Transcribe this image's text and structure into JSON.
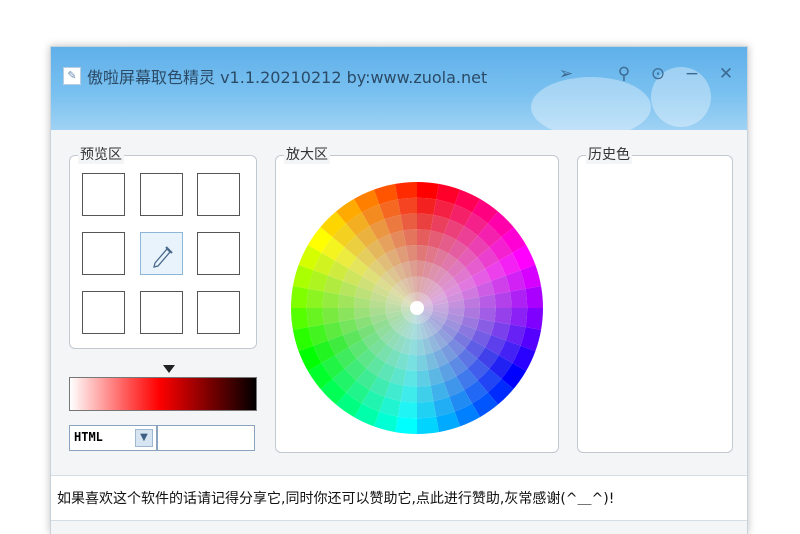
{
  "window": {
    "title": "傲啦屏幕取色精灵 v1.1.20210212 by:www.zuola.net",
    "controls": {
      "send": "➢",
      "pin": "⚲",
      "settings": "⊙",
      "minimize": "−",
      "close": "✕"
    }
  },
  "preview": {
    "label": "预览区",
    "tool_icon": "eyedropper-icon"
  },
  "zoom": {
    "label": "放大区"
  },
  "history": {
    "label": "历史色"
  },
  "color_format": {
    "selected": "HTML",
    "value": ""
  },
  "footer": {
    "message": "如果喜欢这个软件的话请记得分享它,同时你还可以赞助它,点此进行赞助,灰常感谢(^＿^)!"
  },
  "colors": {
    "titlebar": "#6cb8ee",
    "gradient_stops": [
      "#ffffff",
      "#ff0000",
      "#000000"
    ]
  }
}
